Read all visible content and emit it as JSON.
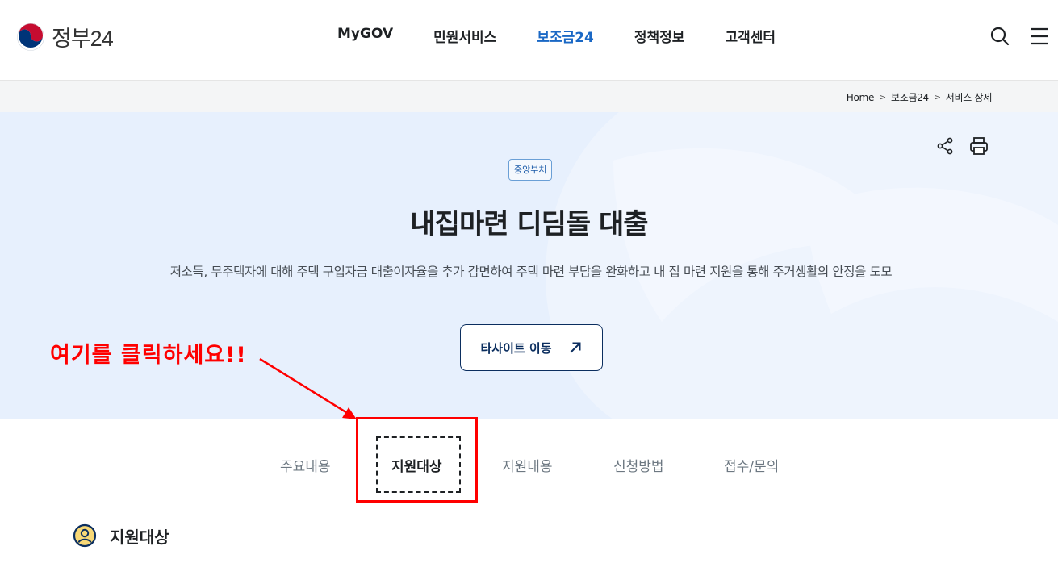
{
  "header": {
    "logo_text": "정부24",
    "nav": [
      {
        "label": "MyGOV",
        "active": false
      },
      {
        "label": "민원서비스",
        "active": false
      },
      {
        "label": "보조금24",
        "active": true
      },
      {
        "label": "정책정보",
        "active": false
      },
      {
        "label": "고객센터",
        "active": false
      }
    ],
    "icons": {
      "search": "search-icon",
      "menu": "hamburger-menu-icon"
    }
  },
  "breadcrumb": {
    "items": [
      "Home",
      "보조금24",
      "서비스 상세"
    ],
    "separator": ">"
  },
  "hero": {
    "agency_badge": "중앙부처",
    "title": "내집마련 디딤돌 대출",
    "description": "저소득, 무주택자에 대해 주택 구입자금 대출이자율을 추가 감면하여 주택 마련 부담을 완화하고 내 집 마련 지원을 통해 주거생활의 안정을 도모",
    "site_button_label": "타사이트 이동",
    "icons": {
      "share": "share-icon",
      "print": "print-icon",
      "external": "external-link-arrow-icon"
    }
  },
  "annotation": {
    "text": "여기를 클릭하세요!!",
    "color": "#ff0000"
  },
  "tabs": {
    "items": [
      {
        "label": "주요내용",
        "active": false
      },
      {
        "label": "지원대상",
        "active": true
      },
      {
        "label": "지원내용",
        "active": false
      },
      {
        "label": "신청방법",
        "active": false
      },
      {
        "label": "접수/문의",
        "active": false
      }
    ]
  },
  "section": {
    "title": "지원대상",
    "icon": "person-circle-icon"
  },
  "colors": {
    "brand_blue": "#1a68c5",
    "navy": "#0b2e5f",
    "hero_bg": "#e7f0fd",
    "annotation_red": "#ff0000"
  }
}
